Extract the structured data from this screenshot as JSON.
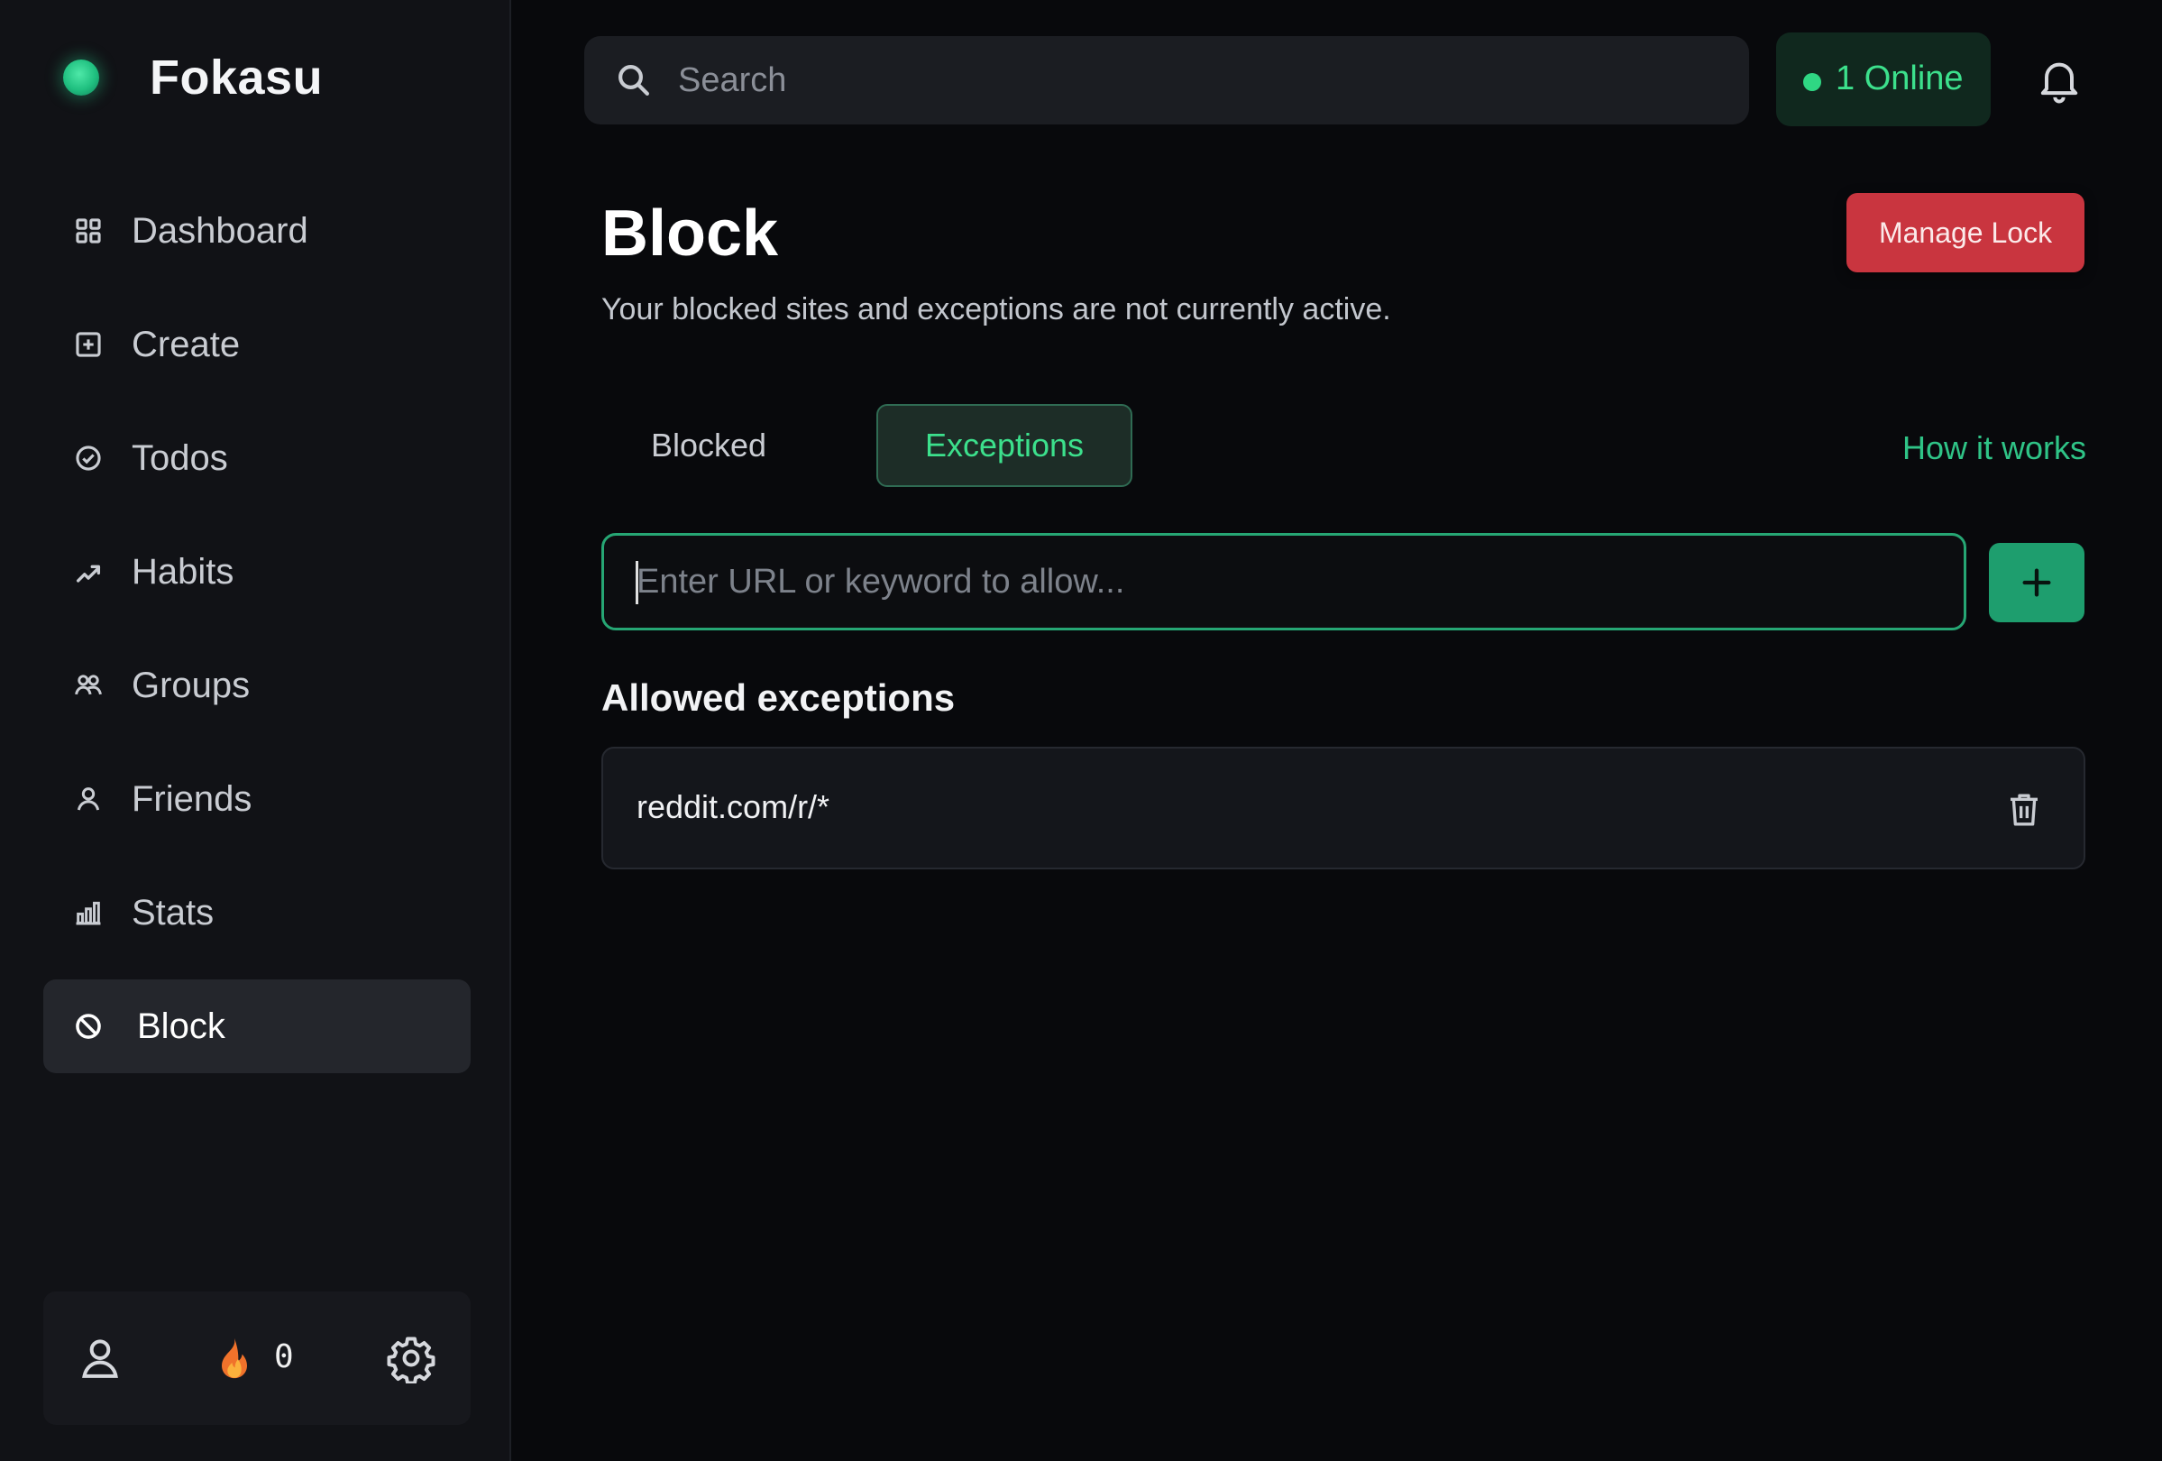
{
  "brand": {
    "name": "Fokasu"
  },
  "sidebar": {
    "items": [
      {
        "label": "Dashboard",
        "icon": "grid-icon"
      },
      {
        "label": "Create",
        "icon": "plus-square-icon"
      },
      {
        "label": "Todos",
        "icon": "check-circle-icon"
      },
      {
        "label": "Habits",
        "icon": "trend-icon"
      },
      {
        "label": "Groups",
        "icon": "users-icon"
      },
      {
        "label": "Friends",
        "icon": "user-icon"
      },
      {
        "label": "Stats",
        "icon": "bar-chart-icon"
      },
      {
        "label": "Block",
        "icon": "ban-icon",
        "active": true
      }
    ],
    "bottom": {
      "streak_count": "0"
    }
  },
  "topbar": {
    "search_placeholder": "Search",
    "online_label": "1 Online"
  },
  "page": {
    "title": "Block",
    "subtitle": "Your blocked sites and exceptions are not currently active.",
    "manage_lock_label": "Manage Lock",
    "tabs": [
      {
        "label": "Blocked",
        "active": false
      },
      {
        "label": "Exceptions",
        "active": true
      }
    ],
    "how_it_works": "How it works",
    "input_placeholder": "Enter URL or keyword to allow...",
    "section_heading": "Allowed exceptions",
    "exceptions": [
      {
        "pattern": "reddit.com/r/*"
      }
    ]
  },
  "colors": {
    "accent": "#1e9e6e",
    "accent_text": "#3ce08c",
    "danger": "#c9353f",
    "background": "#08090c",
    "sidebar": "#111216"
  }
}
